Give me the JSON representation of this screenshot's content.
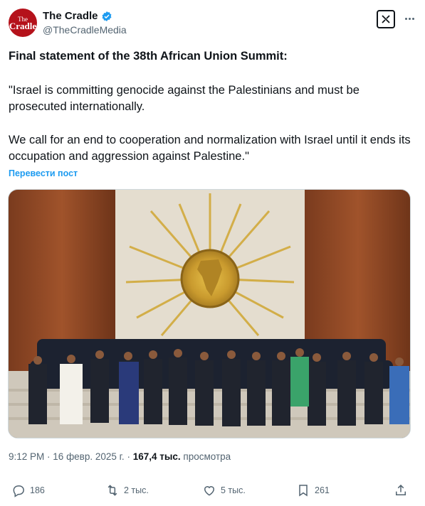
{
  "author": {
    "display_name": "The Cradle",
    "handle": "@TheCradleMedia",
    "avatar_text_top": "The",
    "avatar_text_bottom": "Cradle",
    "verified": true
  },
  "tweet": {
    "headline": "Final statement of the 38th African Union Summit:",
    "paragraph1": "\"Israel is committing genocide against the Palestinians and must be prosecuted internationally.",
    "paragraph2": "We call for an end to cooperation and normalization with Israel until it ends its occupation and aggression against Palestine.\"",
    "translate_label": "Перевести пост"
  },
  "meta": {
    "time": "9:12 PM",
    "date": "16 февр. 2025 г.",
    "views_count": "167,4 тыс.",
    "views_label": "просмотра"
  },
  "actions": {
    "replies": "186",
    "reposts": "2 тыс.",
    "likes": "5 тыс.",
    "bookmarks": "261"
  },
  "colors": {
    "accent": "#1d9bf0",
    "text": "#0f1419",
    "muted": "#536471",
    "avatar_bg": "#b5121b"
  }
}
